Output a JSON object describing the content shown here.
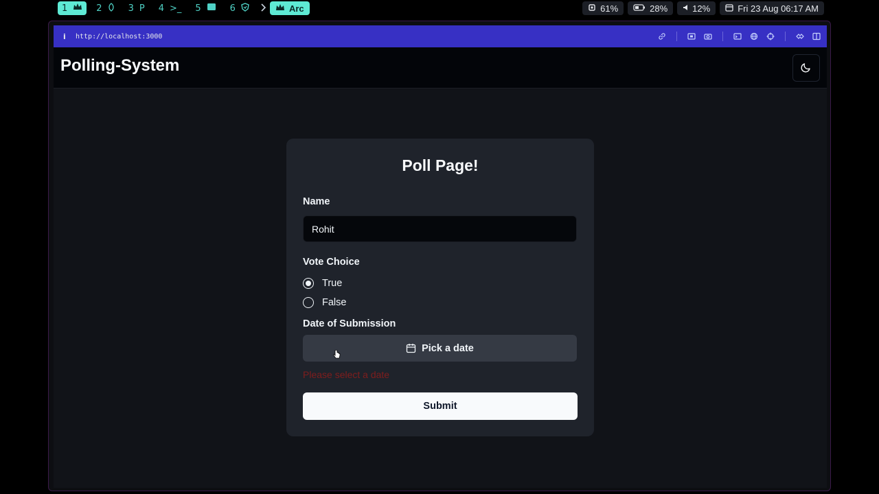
{
  "topbar": {
    "workspaces": [
      {
        "num": "1",
        "icon": "crown-icon"
      },
      {
        "num": "2",
        "icon": "leaf-icon"
      },
      {
        "num": "3",
        "icon": "p-icon",
        "glyph": "P"
      },
      {
        "num": "4",
        "icon": "terminal-icon",
        "glyph": ">_"
      },
      {
        "num": "5",
        "icon": "window-icon"
      },
      {
        "num": "6",
        "icon": "shield-icon"
      }
    ],
    "active_app": "Arc",
    "cpu": "61%",
    "battery": "28%",
    "volume": "12%",
    "datetime": "Fri 23 Aug 06:17 AM"
  },
  "browser": {
    "url": "http://localhost:3000"
  },
  "app": {
    "brand": "Polling-System",
    "card": {
      "title": "Poll Page!",
      "name_label": "Name",
      "name_value": "Rohit",
      "vote_label": "Vote Choice",
      "options": [
        "True",
        "False"
      ],
      "selected": "True",
      "date_label": "Date of Submission",
      "date_button": "Pick a date",
      "error": "Please select a date",
      "submit": "Submit"
    }
  },
  "colors": {
    "accent_workspace": "#5eead4",
    "urlbar": "#3730c4",
    "error": "#7f1d1d"
  }
}
